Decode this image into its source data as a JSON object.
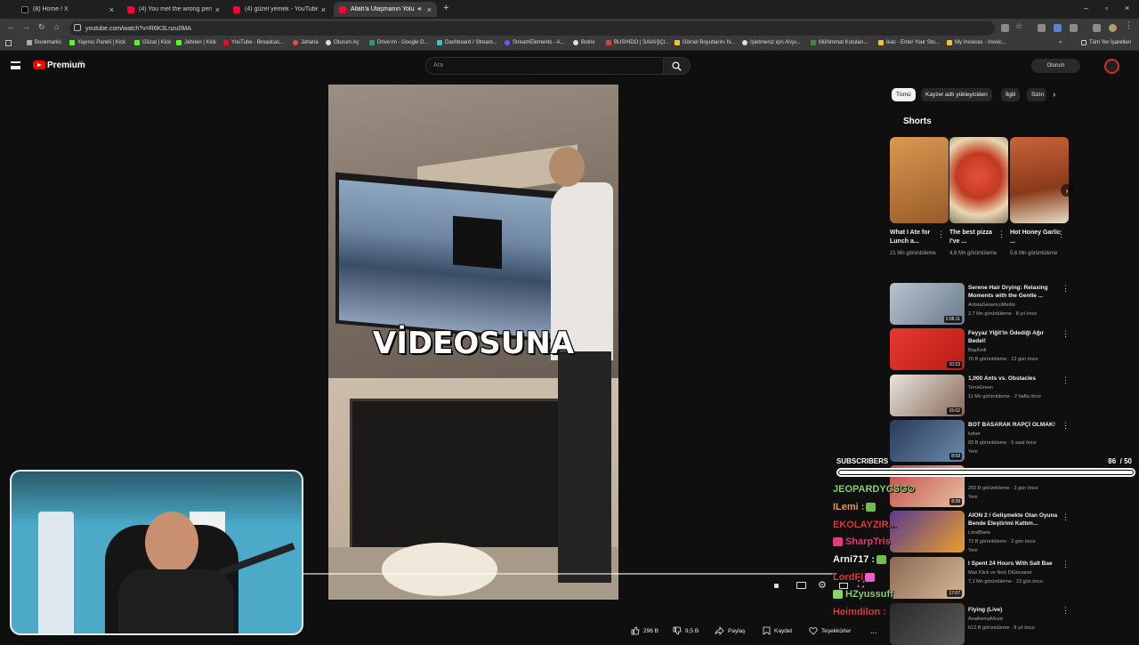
{
  "browser": {
    "tabs": [
      {
        "title": "(8) Home / X",
        "color": "#1d1d1d"
      },
      {
        "title": "(4) You met the wrong person",
        "color": "#ff0033"
      },
      {
        "title": "(4) güzel yemek - YouTube",
        "color": "#ff0033"
      },
      {
        "title": "Allah'a Ulaşmanın Yolu - Yo",
        "color": "#ff0033"
      }
    ],
    "url": "youtube.com/watch?v=R6K3Lnzu0MA",
    "bookmarks": [
      {
        "label": "Bookmarks",
        "color": "#aaaaaa"
      },
      {
        "label": "Yayıncı Paneli | Kick",
        "color": "#53fc18"
      },
      {
        "label": "Gözat | Kick",
        "color": "#53fc18"
      },
      {
        "label": "Jahrein | Kick",
        "color": "#53fc18"
      },
      {
        "label": "YouTube - Broadcas...",
        "color": "#ff0033"
      },
      {
        "label": "Jaharia",
        "color": "#e8523a"
      },
      {
        "label": "Oturum Aç",
        "color": "#dddddd"
      },
      {
        "label": "Drive'ım - Google D...",
        "color": "#1fa463"
      },
      {
        "label": "Dashboard / Stream...",
        "color": "#35c3bd"
      },
      {
        "label": "StreamElements - A...",
        "color": "#7a52f4"
      },
      {
        "label": "Botrix",
        "color": "#dddddd"
      },
      {
        "label": "BUSHIDO | SAVAŞÇI...",
        "color": "#e03a3a"
      },
      {
        "label": "Görsel Boyutlarını N...",
        "color": "#f2c230"
      },
      {
        "label": "İşletmeniz için Alışv...",
        "color": "#dddddd"
      },
      {
        "label": "Mühimmat Kutuları...",
        "color": "#3a8f3a"
      },
      {
        "label": "ikas - Enter Your Sto...",
        "color": "#f2c230"
      },
      {
        "label": "My Invoices - Invoic...",
        "color": "#f2c230"
      },
      {
        "label": "Tüm Yer İşaretleri",
        "color": "#dddddd"
      }
    ]
  },
  "youtube": {
    "premium_label": "Premium",
    "premium_region": "TR",
    "search_placeholder": "Ara",
    "signin_label": "Oturum",
    "video_caption": "VİDEOSUNA",
    "actions": {
      "likes": "296 B",
      "dislikes": "9,5 B",
      "share": "Paylaş",
      "save": "Kaydet",
      "thanks": "Teşekkürler",
      "more": "..."
    },
    "chips": [
      {
        "label": "Tümü",
        "active": true
      },
      {
        "label": "Kayzer adlı yükleyiciden",
        "active": false
      },
      {
        "label": "İlgili",
        "active": false
      },
      {
        "label": "Sizin",
        "active": false
      }
    ],
    "shorts_heading": "Shorts",
    "shorts": [
      {
        "title": "What I Ate for Lunch a...",
        "views": "21 Mn görüntüleme",
        "color": "#b8743a"
      },
      {
        "title": "The best pizza I've ...",
        "views": "4,6 Mn görüntüleme",
        "color": "#c23a22"
      },
      {
        "title": "Hot Honey Garlic ...",
        "views": "5,6 Mn görüntüleme",
        "color": "#a54a28"
      }
    ],
    "recommended": [
      {
        "title": "Serene Hair Drying: Relaxing Moments with the Gentle ...",
        "channel": "ArtistaGenericoMedio",
        "stats": "2,7 Mn görüntüleme · 8 yıl önce",
        "duration": "2:05:11",
        "badge": "",
        "color": "#8ca0b4"
      },
      {
        "title": "Feyyaz Yiğit'in Ödediği Ağır Bedel!",
        "channel": "BaşKedi",
        "stats": "70 B görüntüleme · 12 gün önce",
        "duration": "10:23",
        "badge": "",
        "color": "#d8312a"
      },
      {
        "title": "1,000 Ants vs. Obstacles",
        "channel": "TerraGreen",
        "stats": "11 Mn görüntüleme · 2 hafta önce",
        "duration": "15:02",
        "badge": "",
        "color": "#8a6a58"
      },
      {
        "title": "BOT BASARAK RAPÇİ OLMAK!",
        "channel": "luther",
        "stats": "83 B görüntüleme · 5 saat önce",
        "duration": "8:59",
        "badge": "Yeni",
        "color": "#3a5a8a"
      },
      {
        "title": "",
        "channel": "",
        "stats": "293 B görüntüleme · 3 gün önce",
        "duration": "8:39",
        "badge": "Yeni",
        "color": "#c24a4a"
      },
      {
        "title": "AION 2 / Gelişmekte Olan Oyuna Bende Eleştirimi Kattım...",
        "channel": "LoralBane",
        "stats": "72 B görüntüleme · 2 gün önce",
        "duration": "",
        "badge": "Yeni",
        "color": "#7a5aa0"
      },
      {
        "title": "I Spent 24 Hours With Salt Bae",
        "channel": "Max Klick ve Nick DiGiovanni",
        "stats": "7,1 Mn görüntüleme · 13 gün önce",
        "duration": "17:07",
        "badge": "",
        "color": "#9a6a50"
      },
      {
        "title": "Flying (Live)",
        "channel": "AnathemaMusic",
        "stats": "612 B görüntüleme · 8 yıl önce",
        "duration": "",
        "badge": "",
        "color": "#4a4a4a"
      }
    ]
  },
  "stream_overlay": {
    "subs_label": "SUBSCRIBERS",
    "subs_current": "86",
    "subs_goal": "/ 50",
    "subs_fill_fraction": 1.0,
    "chat": [
      {
        "user": "JEOPARDYCSGO",
        "color": "#8dd35f"
      },
      {
        "user": "ILemi :",
        "color": "#e8a33a"
      },
      {
        "user": "EKOLAYZIR...",
        "color": "#e33a3a"
      },
      {
        "user": "SharpTris",
        "color": "#e83a7a"
      },
      {
        "user": "Arni717 :",
        "color": "#ffffff"
      },
      {
        "user": "LordFi",
        "color": "#e33a3a"
      },
      {
        "user": "HZyussuff",
        "color": "#8dd35f"
      },
      {
        "user": "Heimdilon :",
        "color": "#e33a3a"
      }
    ]
  }
}
